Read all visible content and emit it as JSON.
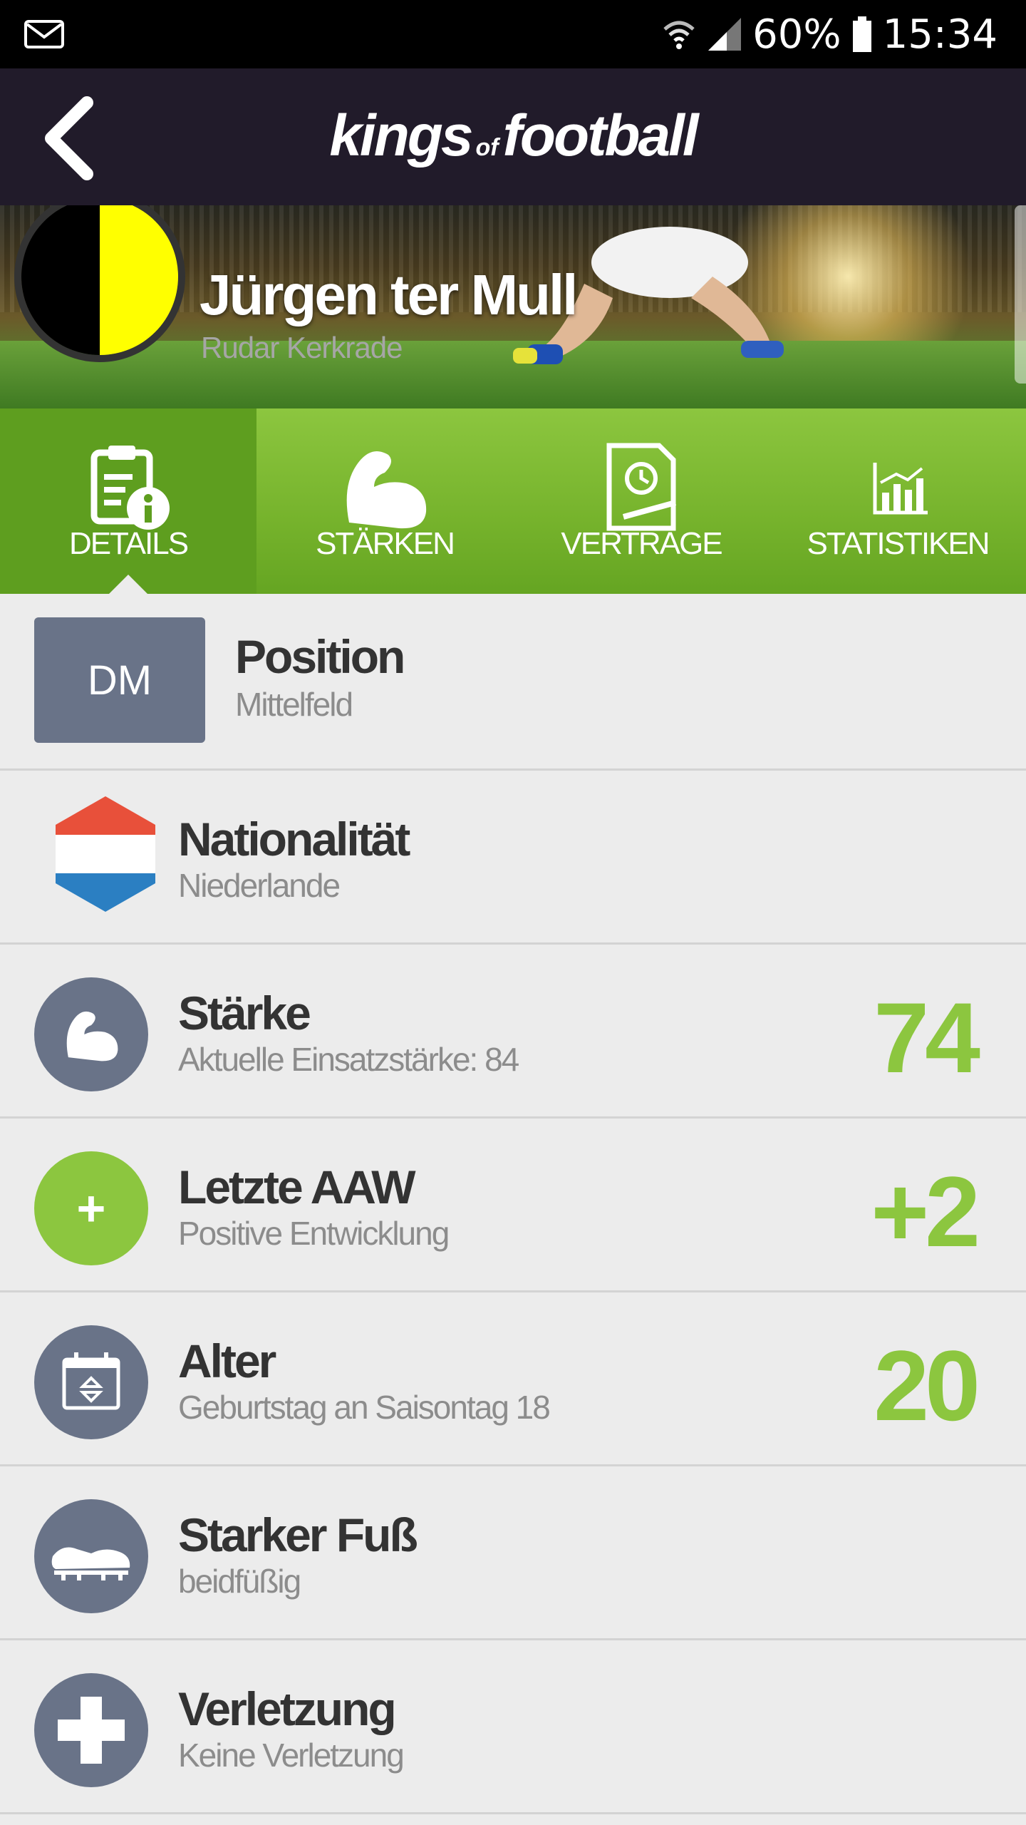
{
  "status_bar": {
    "battery": "60%",
    "time": "15:34"
  },
  "header": {
    "logo_left": "kings",
    "logo_mid": "of",
    "logo_right": "football"
  },
  "player": {
    "name": "Jürgen ter Mull",
    "club": "Rudar Kerkrade"
  },
  "tabs": [
    {
      "label": "DETAILS",
      "icon": "details-icon",
      "active": true
    },
    {
      "label": "STÄRKEN",
      "icon": "muscle-icon"
    },
    {
      "label": "VERTRÄGE",
      "icon": "contract-icon"
    },
    {
      "label": "STATISTIKEN",
      "icon": "stats-icon"
    }
  ],
  "details": {
    "position": {
      "badge": "DM",
      "title": "Position",
      "sub": "Mittelfeld"
    },
    "nationality": {
      "title": "Nationalität",
      "sub": "Niederlande"
    },
    "strength": {
      "title": "Stärke",
      "sub": "Aktuelle Einsatzstärke: 84",
      "value": "74"
    },
    "aaw": {
      "title": "Letzte AAW",
      "sub": "Positive Entwicklung",
      "value": "+2",
      "icon_text": "+"
    },
    "age": {
      "title": "Alter",
      "sub": "Geburtstag an Saisontag 18",
      "value": "20"
    },
    "foot": {
      "title": "Starker Fuß",
      "sub": "beidfüßig"
    },
    "injury": {
      "title": "Verletzung",
      "sub": "Keine Verletzung"
    }
  },
  "colors": {
    "accent_green": "#8cc63f",
    "header_bg": "#211b2a",
    "icon_gray": "#697388"
  }
}
